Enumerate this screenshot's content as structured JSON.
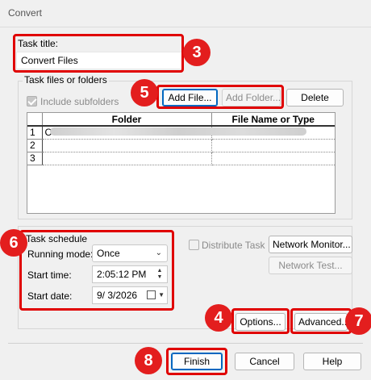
{
  "window": {
    "title": "Convert"
  },
  "task_title": {
    "label": "Task title:",
    "value": "Convert Files"
  },
  "task_files": {
    "group_label": "Task files or folders",
    "include_subfolders": {
      "label": "Include subfolders",
      "checked": true
    },
    "add_file": "Add File...",
    "add_folder": "Add Folder...",
    "delete": "Delete",
    "columns": {
      "folder": "Folder",
      "file_name_type": "File Name or Type"
    },
    "rows": [
      {
        "n": "1",
        "folder": "C",
        "file": ""
      },
      {
        "n": "2",
        "folder": "",
        "file": ""
      },
      {
        "n": "3",
        "folder": "",
        "file": ""
      }
    ]
  },
  "schedule": {
    "group_label": "Task schedule",
    "running_mode_label": "Running mode:",
    "running_mode_value": "Once",
    "start_time_label": "Start time:",
    "start_time_value": "2:05:12 PM",
    "start_date_label": "Start date:",
    "start_date_value": "9/ 3/2026"
  },
  "distribute": {
    "label": "Distribute Task",
    "network_monitor": "Network Monitor...",
    "network_test": "Network Test..."
  },
  "buttons": {
    "options": "Options...",
    "advanced": "Advanced...",
    "finish": "Finish",
    "cancel": "Cancel",
    "help": "Help"
  },
  "badges": [
    "3",
    "5",
    "6",
    "4",
    "7",
    "8"
  ],
  "colors": {
    "annotation_red": "#e00000",
    "badge_red": "#e31e1e",
    "focus_blue": "#0067c0"
  }
}
